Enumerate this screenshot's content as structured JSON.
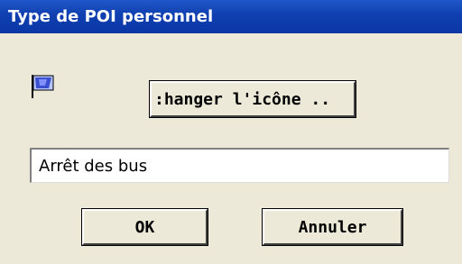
{
  "window": {
    "title": "Type de POI personnel"
  },
  "dialog": {
    "icon": "flag-icon",
    "change_icon_button": ":hanger l'icône ..",
    "name_field_value": "Arrêt des bus",
    "ok_button": "OK",
    "cancel_button": "Annuler"
  },
  "colors": {
    "titlebar": "#0a37a6",
    "dialog_bg": "#ece9d8"
  }
}
